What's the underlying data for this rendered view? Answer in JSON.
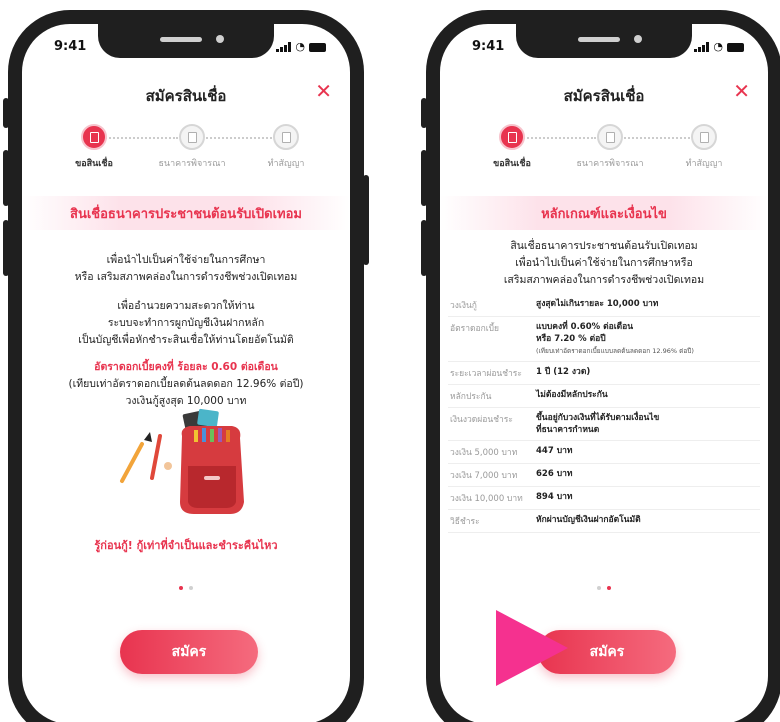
{
  "status": {
    "time": "9:41"
  },
  "header": {
    "title": "สมัครสินเชื่อ",
    "close_icon": "close-icon"
  },
  "steps": [
    {
      "label": "ขอสินเชื่อ"
    },
    {
      "label": "ธนาคารพิจารณา"
    },
    {
      "label": "ทำสัญญา"
    }
  ],
  "left": {
    "banner": "สินเชื่อธนาคารประชาชนต้อนรับเปิดเทอม",
    "para1": [
      "เพื่อนำไปเป็นค่าใช้จ่ายในการศึกษา",
      "หรือ เสริมสภาพคล่องในการดำรงชีพช่วงเปิดเทอม"
    ],
    "para2": [
      "เพื่ออำนวยความสะดวกให้ท่าน",
      "ระบบจะทำการผูกบัญชีเงินฝากหลัก",
      "เป็นบัญชีเพื่อหักชำระสินเชื่อให้ท่านโดยอัตโนมัติ"
    ],
    "rate_line": "อัตราดอกเบี้ยคงที่ ร้อยละ 0.60 ต่อเดือน",
    "rate_sub": "(เทียบเท่าอัตราดอกเบี้ยลดต้นลดดอก 12.96% ต่อปี)",
    "limit_line": "วงเงินกู้สูงสุด 10,000 บาท",
    "slogan": "รู้ก่อนกู้! กู้เท่าที่จำเป็นและชำระคืนไหว",
    "button": "สมัคร",
    "active_dot": 0
  },
  "right": {
    "banner": "หลักเกณฑ์และเงื่อนไข",
    "intro": [
      "สินเชื่อธนาคารประชาชนต้อนรับเปิดเทอม",
      "เพื่อนำไปเป็นค่าใช้จ่ายในการศึกษาหรือ",
      "เสริมสภาพคล่องในการดำรงชีพช่วงเปิดเทอม"
    ],
    "terms": [
      {
        "key": "วงเงินกู้",
        "value": "สูงสุดไม่เกินรายละ 10,000 บาท"
      },
      {
        "key": "อัตราดอกเบี้ย",
        "value": "แบบคงที่ 0.60% ต่อเดือน",
        "value2": "หรือ 7.20 % ต่อปี",
        "note": "(เทียบเท่าอัตราดอกเบี้ยแบบลดต้นลดดอก 12.96% ต่อปี)"
      },
      {
        "key": "ระยะเวลาผ่อนชำระ",
        "value": "1 ปี (12 งวด)"
      },
      {
        "key": "หลักประกัน",
        "value": "ไม่ต้องมีหลักประกัน"
      },
      {
        "key": "เงินงวดผ่อนชำระ",
        "value": "ขึ้นอยู่กับวงเงินที่ได้รับตามเงื่อนไข",
        "value2": "ที่ธนาคารกำหนด"
      },
      {
        "key": "วงเงิน 5,000 บาท",
        "value": "447 บาท"
      },
      {
        "key": "วงเงิน 7,000 บาท",
        "value": "626 บาท"
      },
      {
        "key": "วงเงิน 10,000 บาท",
        "value": "894 บาท"
      },
      {
        "key": "วิธีชำระ",
        "value": "หักผ่านบัญชีเงินฝากอัตโนมัติ"
      }
    ],
    "button": "สมัคร",
    "active_dot": 1
  },
  "colors": {
    "accent": "#e8344f",
    "banner_bg": "#fde2ea",
    "overlay_arrow": "#f5318f"
  }
}
